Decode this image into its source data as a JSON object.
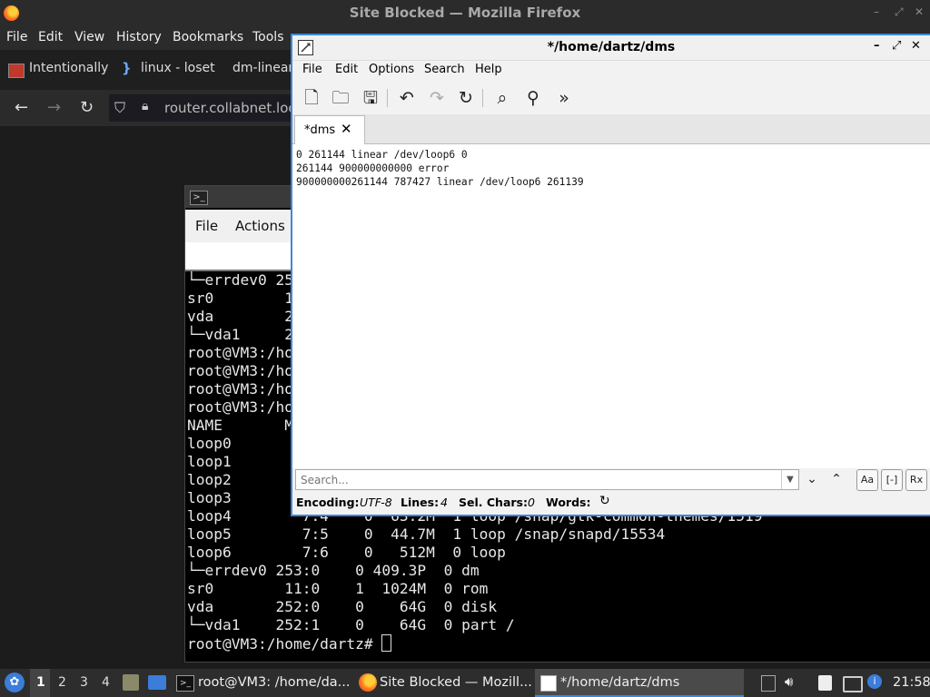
{
  "firefox": {
    "title": "Site Blocked — Mozilla Firefox",
    "menu": [
      "File",
      "Edit",
      "View",
      "History",
      "Bookmarks",
      "Tools"
    ],
    "tabs": [
      "Intentionally",
      "linux - loset",
      "dm-linear"
    ],
    "url": "router.collabnet.loca",
    "controls": [
      "–",
      "⤢",
      "✕"
    ]
  },
  "terminal": {
    "icon": ">_",
    "menu": [
      "File",
      "Actions"
    ],
    "lines": [
      "└─errdev0 25",
      "sr0        1",
      "vda        25",
      "└─vda1     25",
      "root@VM3:/ho",
      "root@VM3:/ho",
      "root@VM3:/ho",
      "root@VM3:/ho",
      "NAME       MA",
      "loop0",
      "loop1",
      "loop2",
      "loop3",
      "loop4        7:4    0  63.2M  1 loop /snap/gtk-common-themes/1519",
      "loop5        7:5    0  44.7M  1 loop /snap/snapd/15534",
      "loop6        7:6    0   512M  0 loop",
      "└─errdev0 253:0    0 409.3P  0 dm",
      "sr0        11:0    1  1024M  0 rom",
      "vda       252:0    0    64G  0 disk",
      "└─vda1    252:1    0    64G  0 part /"
    ],
    "prompt": "root@VM3:/home/dartz# "
  },
  "editor": {
    "title": "*/home/dartz/dms",
    "controls": [
      "–",
      "⤢",
      "✕"
    ],
    "menu": [
      "File",
      "Edit",
      "Options",
      "Search",
      "Help"
    ],
    "tab_label": "*dms",
    "tab_close": "✕",
    "lines": [
      "0 261144 linear /dev/loop6 0",
      "261144 900000000000 error",
      "900000000261144 787427 linear /dev/loop6 261139"
    ],
    "search_placeholder": "Search...",
    "status": {
      "encoding_label": "Encoding:",
      "encoding_value": "UTF-8",
      "lines_label": "Lines:",
      "lines_value": "4",
      "sel_label": "Sel. Chars:",
      "sel_value": "0",
      "words_label": "Words:"
    },
    "search_buttons": {
      "regex": "Rx",
      "case": "Aa",
      "whole": "[-]"
    }
  },
  "taskbar": {
    "workspaces": [
      "1",
      "2",
      "3",
      "4"
    ],
    "tasks": [
      "root@VM3: /home/da...",
      "Site Blocked — Mozill...",
      "*/home/dartz/dms"
    ],
    "clock": "21:58"
  }
}
